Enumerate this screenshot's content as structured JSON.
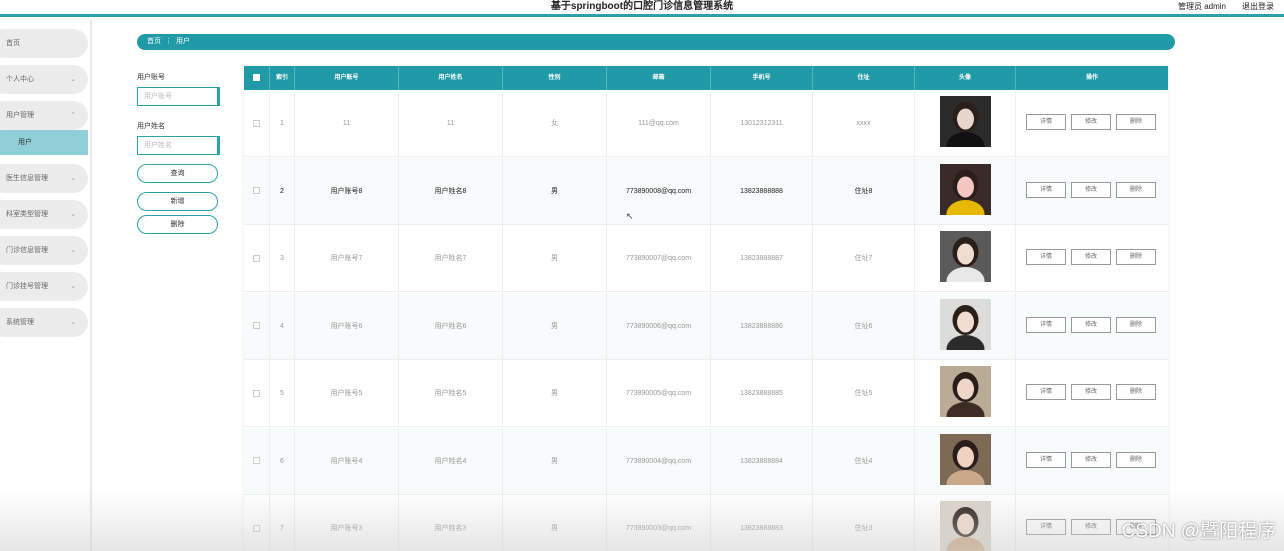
{
  "header": {
    "title": "基于springboot的口腔门诊信息管理系统",
    "user": "管理员 admin",
    "logout": "退出登录"
  },
  "sidebar": {
    "items": [
      {
        "label": "首页"
      },
      {
        "label": "个人中心"
      },
      {
        "label": "用户管理"
      },
      {
        "label": "医生信息管理"
      },
      {
        "label": "科室类型管理"
      },
      {
        "label": "门诊信息管理"
      },
      {
        "label": "门诊挂号管理"
      },
      {
        "label": "系统管理"
      }
    ],
    "active_sub": "用户"
  },
  "breadcrumb": {
    "home": "首页",
    "sep": "⋮",
    "current": "用户"
  },
  "search": {
    "account_label": "用户账号",
    "account_placeholder": "用户账号",
    "name_label": "用户姓名",
    "name_placeholder": "用户姓名",
    "query": "查询",
    "add": "新增",
    "delete": "删除"
  },
  "table": {
    "columns": [
      "索引",
      "用户账号",
      "用户姓名",
      "性别",
      "邮箱",
      "手机号",
      "住址",
      "头像",
      "操作"
    ],
    "rows": [
      {
        "index": "1",
        "account": "11",
        "name": "11",
        "gender": "女",
        "email": "111@qq.com",
        "phone": "13012312311",
        "address": "xxxx"
      },
      {
        "index": "2",
        "account": "用户账号8",
        "name": "用户姓名8",
        "gender": "男",
        "email": "773890008@qq.com",
        "phone": "13823888888",
        "address": "住址8"
      },
      {
        "index": "3",
        "account": "用户账号7",
        "name": "用户姓名7",
        "gender": "男",
        "email": "773890007@qq.com",
        "phone": "13823888887",
        "address": "住址7"
      },
      {
        "index": "4",
        "account": "用户账号6",
        "name": "用户姓名6",
        "gender": "男",
        "email": "773890006@qq.com",
        "phone": "13823888886",
        "address": "住址6"
      },
      {
        "index": "5",
        "account": "用户账号5",
        "name": "用户姓名5",
        "gender": "男",
        "email": "773890005@qq.com",
        "phone": "13823888885",
        "address": "住址5"
      },
      {
        "index": "6",
        "account": "用户账号4",
        "name": "用户姓名4",
        "gender": "男",
        "email": "773890004@qq.com",
        "phone": "13823888884",
        "address": "住址4"
      },
      {
        "index": "7",
        "account": "用户账号3",
        "name": "用户姓名3",
        "gender": "男",
        "email": "773890003@qq.com",
        "phone": "13823888883",
        "address": "住址3"
      }
    ],
    "actions": {
      "detail": "详情",
      "edit": "修改",
      "delete": "删除"
    }
  },
  "watermark": "CSDN @暨阳程序"
}
